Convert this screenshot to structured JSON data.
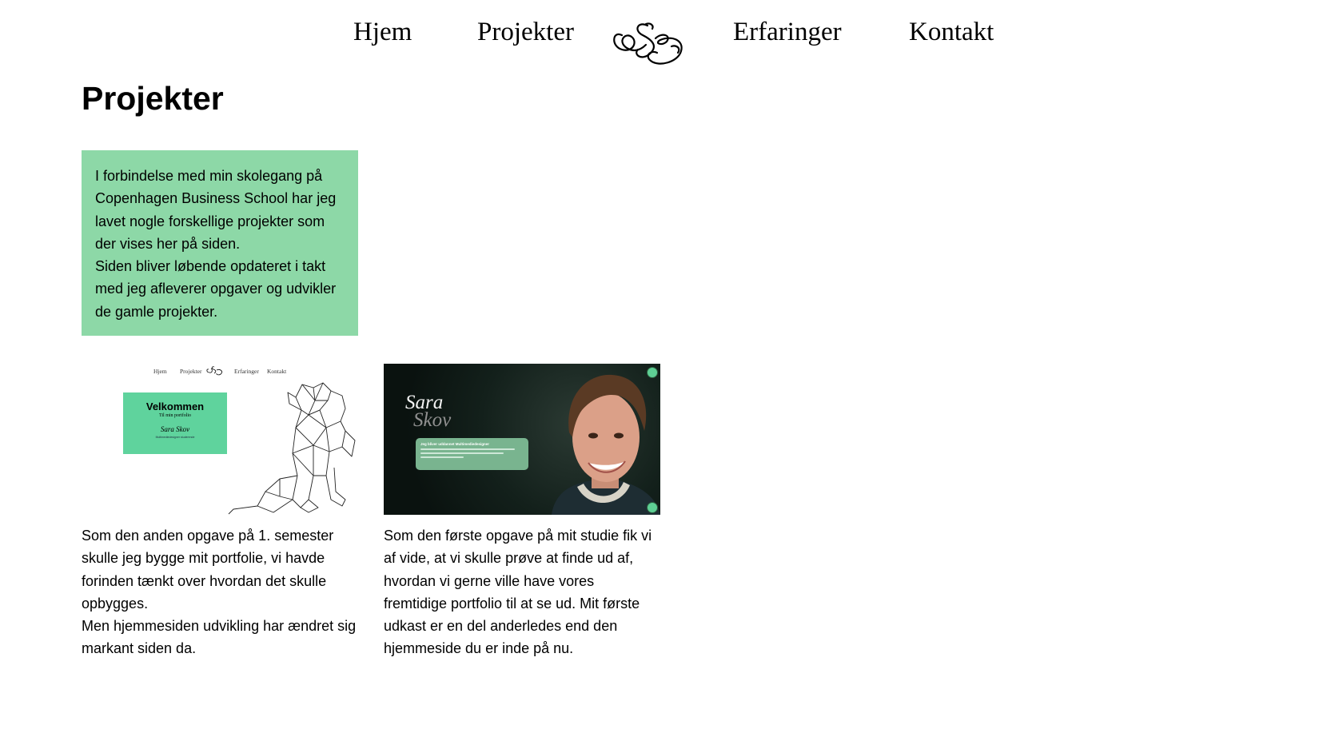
{
  "nav": {
    "items": [
      "Hjem",
      "Projekter",
      "Erfaringer",
      "Kontakt"
    ],
    "logo_text": "SS"
  },
  "page": {
    "title": "Projekter",
    "intro": [
      "I forbindelse med min skolegang på Copenhagen Business School har jeg lavet nogle forskellige projekter som der vises her på siden.",
      "Siden bliver løbende opdateret i takt med jeg afleverer opgaver og udvikler de gamle projekter."
    ]
  },
  "projects": [
    {
      "thumbnail": {
        "nav": [
          "Hjem",
          "Projekter",
          "Erfaringer",
          "Kontakt"
        ],
        "heading": "Velkommen",
        "subheading": "Til min portfolio",
        "name": "Sara Skov",
        "footer": "Multimediedesigner studerende"
      },
      "description": [
        "Som den anden opgave på 1. semester skulle jeg bygge mit portfolie, vi havde forinden tænkt over hvordan det skulle opbygges.",
        "Men hjemmesiden udvikling har ændret sig markant siden da."
      ]
    },
    {
      "thumbnail": {
        "name_first": "Sara",
        "name_last": "Skov",
        "bubble_heading": "Jeg bliver uddannet Multimediedesigner"
      },
      "description": [
        "Som den første opgave på mit studie fik vi af vide, at vi skulle prøve at finde ud af, hvordan vi gerne ville have vores fremtidige portfolio til at se ud. Mit første udkast er en del anderledes end den hjemmeside du er inde på nu."
      ]
    }
  ],
  "colors": {
    "intro_bg": "#8dd8a7",
    "accent_green": "#5fd39d",
    "text": "#000000"
  }
}
